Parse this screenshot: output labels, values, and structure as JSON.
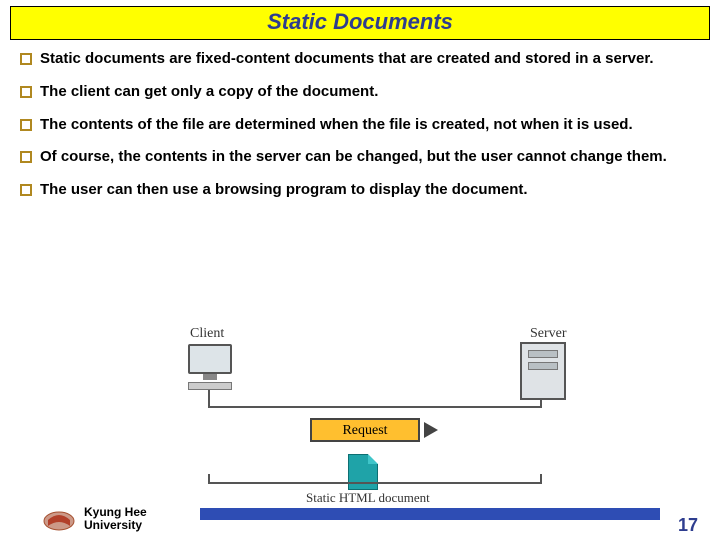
{
  "title": "Static Documents",
  "bullets": [
    "Static documents are fixed-content documents that are created and stored in a server.",
    "The client can get only a copy of the document.",
    "The contents of the file are determined when the file is created, not when it is used.",
    "Of course, the contents in the server can be changed, but the user cannot change them.",
    "The user can then use a browsing program to display the document."
  ],
  "diagram": {
    "client_label": "Client",
    "server_label": "Server",
    "request_label": "Request",
    "caption": "Static HTML document"
  },
  "footer": {
    "university_line1": "Kyung Hee",
    "university_line2": "University",
    "page_number": "17"
  }
}
